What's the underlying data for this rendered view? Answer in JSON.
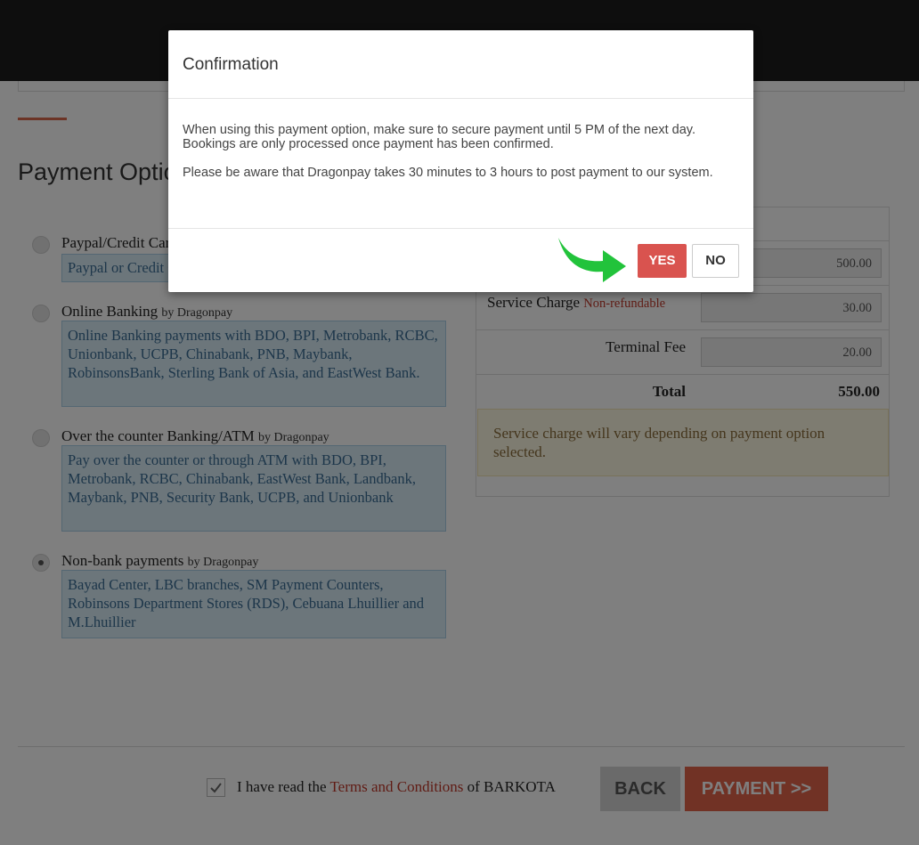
{
  "page": {
    "section_title": "Payment Options"
  },
  "options": [
    {
      "title": "Paypal/Credit Card",
      "by": "",
      "description": "Paypal or Credit Card",
      "selected": false
    },
    {
      "title": "Online Banking",
      "by": "by Dragonpay",
      "description": "Online Banking payments with BDO, BPI, Metrobank, RCBC, Unionbank, UCPB, Chinabank, PNB, Maybank, RobinsonsBank, Sterling Bank of Asia, and EastWest Bank.",
      "selected": false
    },
    {
      "title": "Over the counter Banking/ATM",
      "by": "by Dragonpay",
      "description": "Pay over the counter or through ATM with BDO, BPI, Metrobank, RCBC, Chinabank, EastWest Bank, Landbank, Maybank, PNB, Security Bank, UCPB, and Unionbank",
      "selected": false
    },
    {
      "title": "Non-bank payments",
      "by": "by Dragonpay",
      "description": "Bayad Center, LBC branches, SM Payment Counters, Robinsons Department Stores (RDS), Cebuana Lhuillier and M.Lhuillier",
      "selected": true
    }
  ],
  "summary": {
    "fare_value": "500.00",
    "service_charge_label": "Service Charge",
    "service_charge_note": "Non-refundable",
    "service_charge_value": "30.00",
    "terminal_fee_label": "Terminal Fee",
    "terminal_fee_value": "20.00",
    "total_label": "Total",
    "total_value": "550.00",
    "notice": "Service charge will vary depending on payment option selected."
  },
  "footer": {
    "terms_prefix": "I have read the ",
    "terms_link": "Terms and Conditions",
    "terms_suffix": " of BARKOTA",
    "terms_checked": true,
    "back_label": "BACK",
    "payment_label": "PAYMENT >>"
  },
  "modal": {
    "title": "Confirmation",
    "paragraph1": "When using this payment option, make sure to secure payment until 5 PM of the next day. Bookings are only processed once payment has been confirmed.",
    "paragraph2": "Please be aware that Dragonpay takes 30 minutes to 3 hours to post payment to our system.",
    "yes_label": "YES",
    "no_label": "NO"
  },
  "colors": {
    "accent": "#e2644a",
    "yes_button": "#d9534f",
    "arrow": "#22c33b",
    "info_bg": "#d9ecf7",
    "notice_bg": "#fcf8e3"
  }
}
